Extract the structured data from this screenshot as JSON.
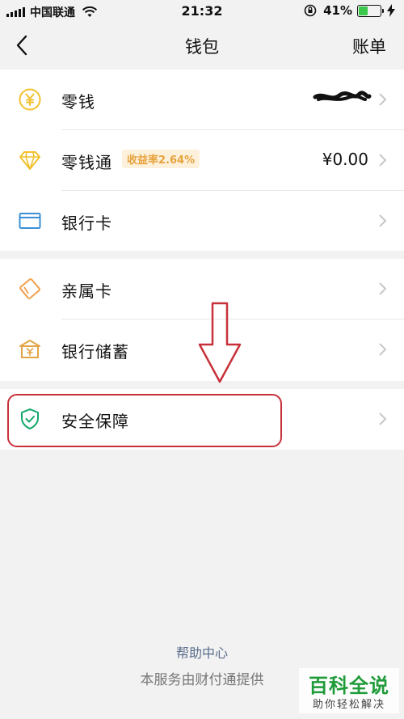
{
  "status_bar": {
    "carrier": "中国联通",
    "time": "21:32",
    "battery_percent": "41%",
    "battery_level": 0.41
  },
  "nav": {
    "title": "钱包",
    "action": "账单"
  },
  "groups": [
    {
      "rows": [
        {
          "label": "零钱",
          "icon": "yuan-coin-icon",
          "value_redacted": true
        },
        {
          "label": "零钱通",
          "icon": "diamond-icon",
          "badge": "收益率2.64%",
          "value": "¥0.00"
        },
        {
          "label": "银行卡",
          "icon": "bank-card-icon"
        }
      ]
    },
    {
      "rows": [
        {
          "label": "亲属卡",
          "icon": "family-card-icon"
        },
        {
          "label": "银行储蓄",
          "icon": "bank-savings-icon"
        }
      ]
    },
    {
      "rows": [
        {
          "label": "安全保障",
          "icon": "shield-icon"
        }
      ]
    }
  ],
  "footer": {
    "help": "帮助中心",
    "provided_by": "本服务由财付通提供"
  },
  "watermark": {
    "title": "百科全说",
    "subtitle": "助你轻松解决"
  },
  "colors": {
    "accent_yellow": "#f2c12e",
    "badge_text": "#e7a23c",
    "badge_bg": "#fdf1dc",
    "bank_card_blue": "#3a8fd6",
    "shield_green": "#13a86b",
    "annotation_red": "#c7313a",
    "battery_green": "#3cc84a",
    "link_blue": "#5a6d8c"
  }
}
